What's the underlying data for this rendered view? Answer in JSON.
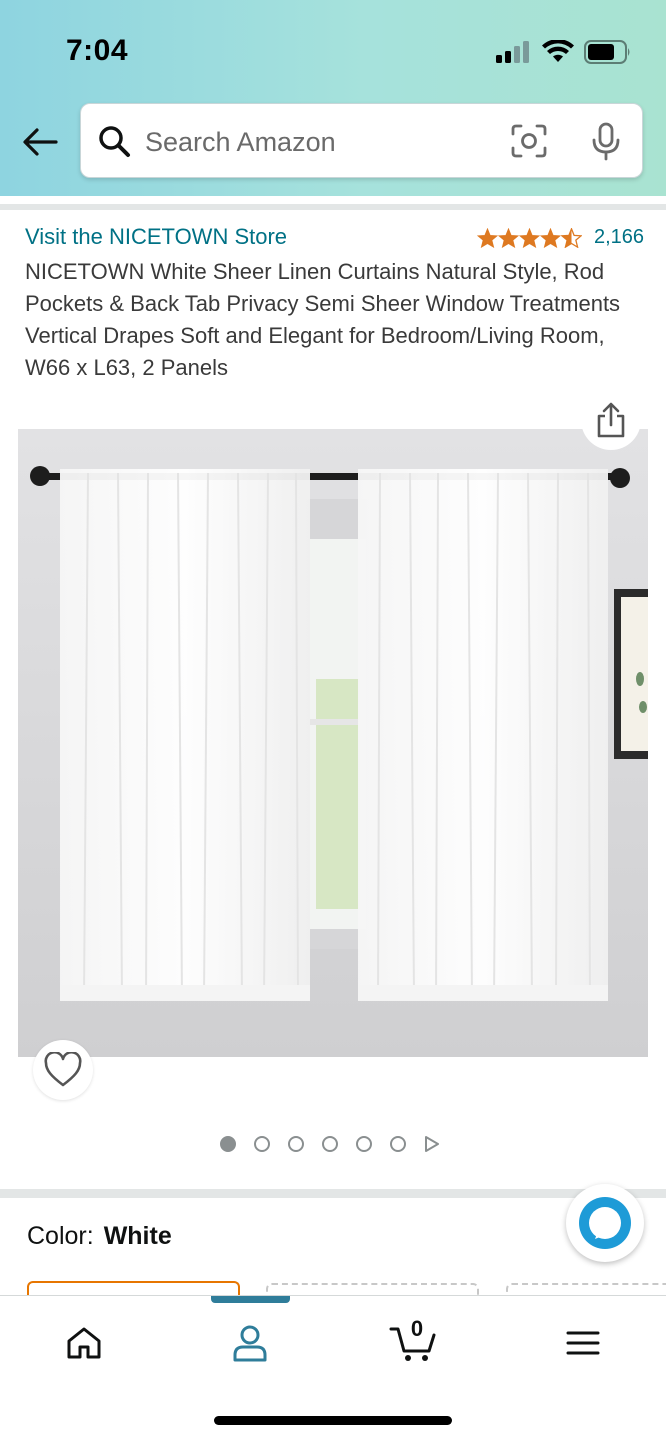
{
  "status_bar": {
    "time": "7:04"
  },
  "search": {
    "placeholder": "Search Amazon"
  },
  "product": {
    "store_link": "Visit the NICETOWN Store",
    "rating_value": 4.5,
    "rating_count": "2,166",
    "title": "NICETOWN White Sheer Linen Curtains Natural Style, Rod Pockets & Back Tab Privacy Semi Sheer Window Treatments Vertical Drapes Soft and Elegant for Bedroom/Living Room, W66 x L63, 2 Panels"
  },
  "image_carousel": {
    "total_dots": 6,
    "active_index": 0
  },
  "color": {
    "label": "Color:",
    "value": "White"
  },
  "bottom_nav": {
    "items": [
      "home-icon",
      "account-icon",
      "cart-icon",
      "menu-icon"
    ],
    "active": "account-icon",
    "cart_count": "0"
  },
  "colors": {
    "link": "#007185",
    "star": "#de7921",
    "header_gradient_start": "#8ed4e0",
    "header_gradient_end": "#a9e3d1",
    "nav_active": "#2f7d9a"
  }
}
